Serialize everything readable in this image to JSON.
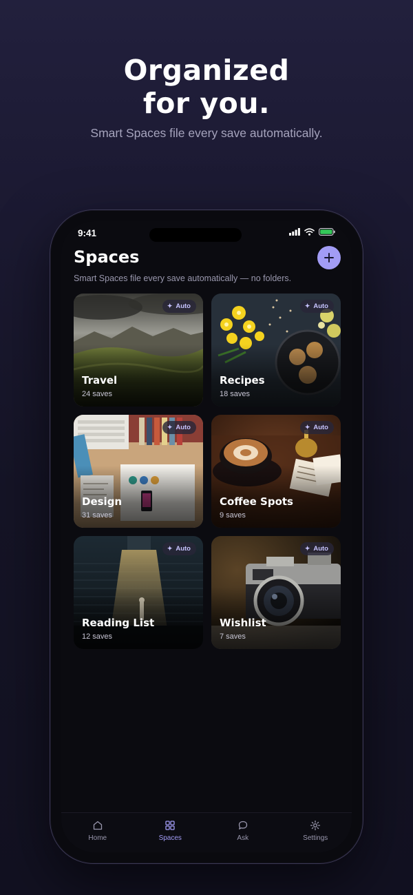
{
  "hero": {
    "title_line1": "Organized",
    "title_line2": "for you.",
    "subtitle": "Smart Spaces file every save automatically."
  },
  "status_bar": {
    "time": "9:41",
    "icons": [
      "cellular-signal-icon",
      "wifi-icon",
      "battery-icon"
    ]
  },
  "header": {
    "title": "Spaces",
    "subtitle": "Smart Spaces file every save automatically — no folders.",
    "add_icon": "plus-icon"
  },
  "accent_color": "#a29cf5",
  "badge_icon": "sparkle-icon",
  "spaces": [
    {
      "name": "Travel",
      "count": "24 saves",
      "badge": "Auto"
    },
    {
      "name": "Recipes",
      "count": "18 saves",
      "badge": "Auto"
    },
    {
      "name": "Design",
      "count": "31 saves",
      "badge": "Auto"
    },
    {
      "name": "Coffee Spots",
      "count": "9 saves",
      "badge": "Auto"
    },
    {
      "name": "Reading List",
      "count": "12 saves",
      "badge": "Auto"
    },
    {
      "name": "Wishlist",
      "count": "7 saves",
      "badge": "Auto"
    }
  ],
  "tabbar": [
    {
      "label": "Home",
      "icon": "home-icon",
      "active": false
    },
    {
      "label": "Spaces",
      "icon": "grid-icon",
      "active": true
    },
    {
      "label": "Ask",
      "icon": "chat-bubble-icon",
      "active": false
    },
    {
      "label": "Settings",
      "icon": "gear-icon",
      "active": false
    }
  ]
}
